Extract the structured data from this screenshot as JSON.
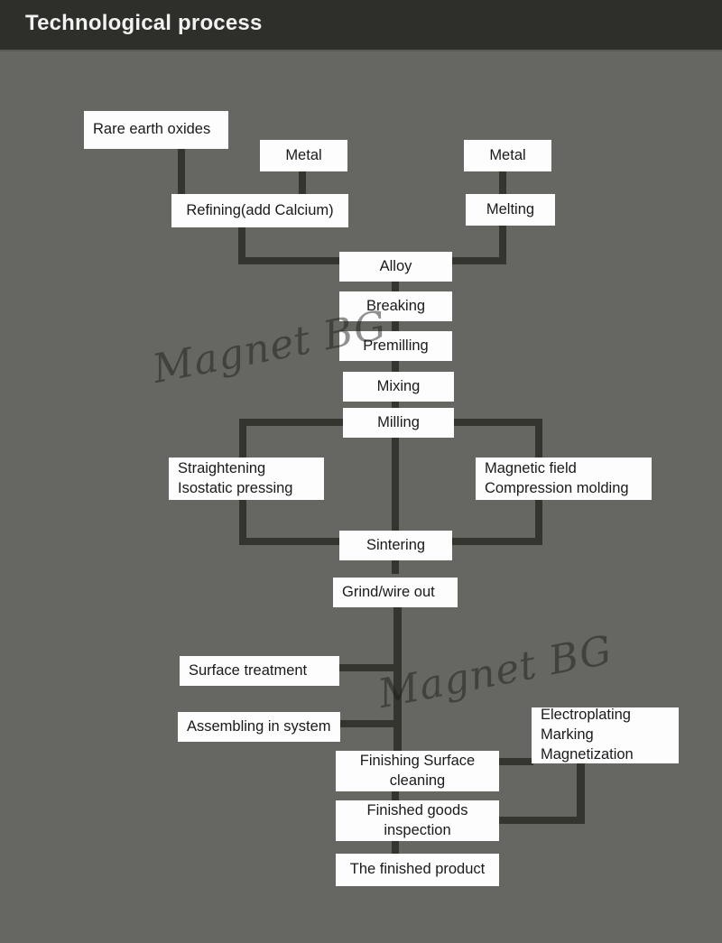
{
  "header": {
    "title": "Technological process"
  },
  "colors": {
    "header_bg": "#2e2e2b",
    "page_bg": "#666663",
    "node_bg": "#fdfdfd",
    "node_text": "#1a1a1a",
    "connector": "#35352f",
    "header_text": "#f2f2f0"
  },
  "watermarks": [
    {
      "text": "Magnet BG"
    },
    {
      "text": "Magnet BG"
    }
  ],
  "diagram": {
    "type": "flowchart",
    "nodes": [
      {
        "id": "rare-earth-oxides",
        "label": "Rare earth oxides"
      },
      {
        "id": "metal-left",
        "label": "Metal"
      },
      {
        "id": "metal-right",
        "label": "Metal"
      },
      {
        "id": "refining",
        "label": "Refining(add Calcium)"
      },
      {
        "id": "melting",
        "label": "Melting"
      },
      {
        "id": "alloy",
        "label": "Alloy"
      },
      {
        "id": "breaking",
        "label": "Breaking"
      },
      {
        "id": "premilling",
        "label": "Premilling"
      },
      {
        "id": "mixing",
        "label": "Mixing"
      },
      {
        "id": "milling",
        "label": "Milling"
      },
      {
        "id": "straightening",
        "label": "Straightening\nIsostatic pressing"
      },
      {
        "id": "magnetic-field",
        "label": "Magnetic field\nCompression molding"
      },
      {
        "id": "sintering",
        "label": "Sintering"
      },
      {
        "id": "grind-wire-out",
        "label": "Grind/wire out"
      },
      {
        "id": "surface-treatment",
        "label": "Surface treatment"
      },
      {
        "id": "assembling-in-system",
        "label": "Assembling in system"
      },
      {
        "id": "electroplating",
        "label": "Electroplating\nMarking\n  Magnetization"
      },
      {
        "id": "finishing-surface",
        "label": "Finishing Surface\ncleaning"
      },
      {
        "id": "finished-goods",
        "label": "Finished goods\ninspection"
      },
      {
        "id": "finished-product",
        "label": "The finished product"
      }
    ]
  }
}
